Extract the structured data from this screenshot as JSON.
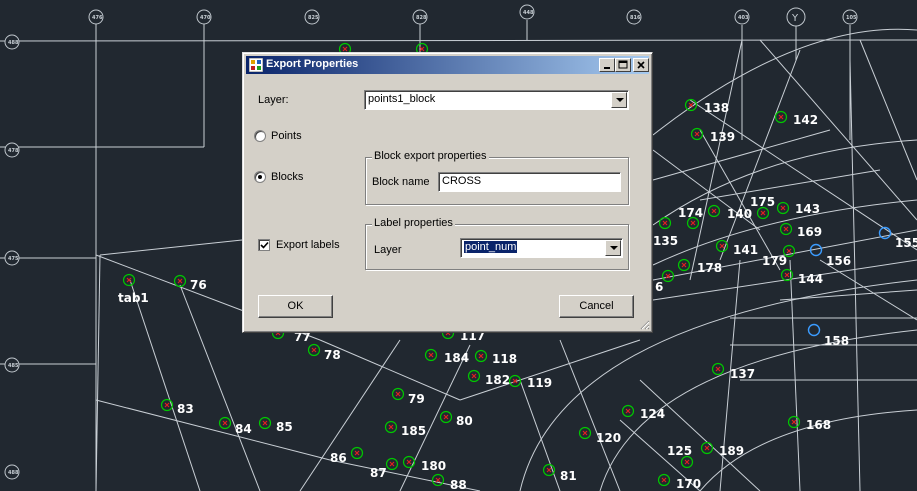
{
  "dialog": {
    "title": "Export Properties",
    "layer_label": "Layer:",
    "layer_value": "points1_block",
    "radio_points": "Points",
    "radio_blocks": "Blocks",
    "selected_mode": "Blocks",
    "block_group_title": "Block export properties",
    "block_name_label": "Block name",
    "block_name_value": "CROSS",
    "export_labels": "Export labels",
    "export_labels_checked": true,
    "label_group_title": "Label properties",
    "label_layer_label": "Layer",
    "label_layer_value": "point_num",
    "ok": "OK",
    "cancel": "Cancel",
    "minimize_icon": "minimize-icon",
    "maximize_icon": "maximize-icon",
    "close_icon": "close-icon"
  },
  "drawing": {
    "point_labels": [
      "138",
      "142",
      "139",
      "174",
      "175",
      "140",
      "143",
      "135",
      "169",
      "141",
      "155",
      "156",
      "179",
      "178",
      "144",
      "6",
      "158",
      "tab1",
      "76",
      "77",
      "117",
      "78",
      "184",
      "118",
      "182",
      "119",
      "79",
      "83",
      "84",
      "85",
      "185",
      "80",
      "137",
      "124",
      "120",
      "168",
      "125",
      "189",
      "86",
      "87",
      "180",
      "88",
      "81",
      "170"
    ],
    "grid_bubbles": [
      "476",
      "470",
      "825",
      "828",
      "448",
      "816",
      "403",
      "Y",
      "105",
      "488",
      "478",
      "475",
      "485",
      "488"
    ],
    "colors": {
      "background": "#212830",
      "lines": "#c9cfd5",
      "point_circle": "#00c800",
      "point_cross": "#e02020",
      "highlight": "#3b9cff"
    }
  }
}
